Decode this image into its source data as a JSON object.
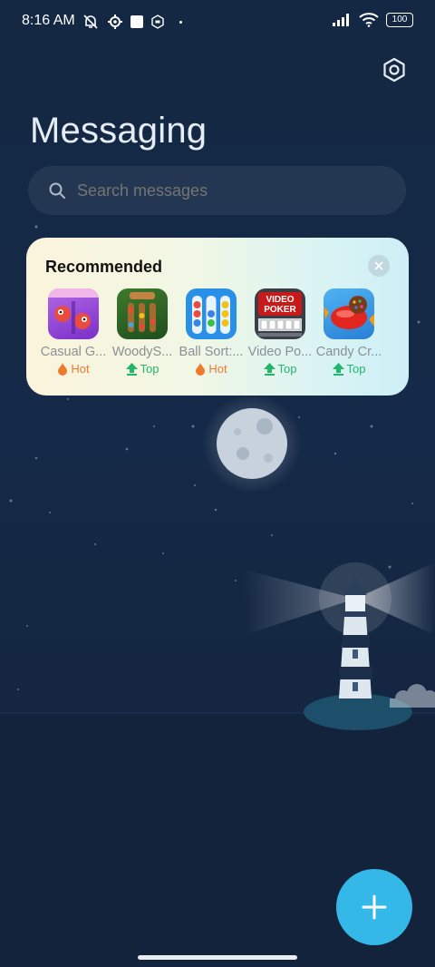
{
  "status_bar": {
    "time": "8:16 AM",
    "battery": "100",
    "icons_left": [
      "mute-icon",
      "gear-icon",
      "square-icon",
      "hexagon-icon",
      "dot-icon"
    ],
    "icons_right": [
      "signal-icon",
      "wifi-icon",
      "battery-icon"
    ]
  },
  "header": {
    "title": "Messaging",
    "settings_icon": "settings-hexagon-icon"
  },
  "search": {
    "placeholder": "Search messages"
  },
  "recommended": {
    "title": "Recommended",
    "close_icon": "close-icon",
    "apps": [
      {
        "name": "Casual G...",
        "badge": "Hot",
        "badge_type": "hot",
        "icon": "casual-game-icon"
      },
      {
        "name": "WoodyS...",
        "badge": "Top",
        "badge_type": "top",
        "icon": "woody-sort-icon"
      },
      {
        "name": "Ball Sort:...",
        "badge": "Hot",
        "badge_type": "hot",
        "icon": "ball-sort-icon"
      },
      {
        "name": "Video Po...",
        "badge": "Top",
        "badge_type": "top",
        "icon": "video-poker-icon"
      },
      {
        "name": "Candy Cr...",
        "badge": "Top",
        "badge_type": "top",
        "icon": "candy-crush-icon"
      }
    ],
    "video_poker_icon_text": [
      "VIDEO",
      "POKER"
    ]
  },
  "fab": {
    "icon": "plus-icon"
  },
  "colors": {
    "accent": "#34b8e8",
    "background": "#152a48",
    "hot": "#f07a2b",
    "top": "#23b56a"
  }
}
